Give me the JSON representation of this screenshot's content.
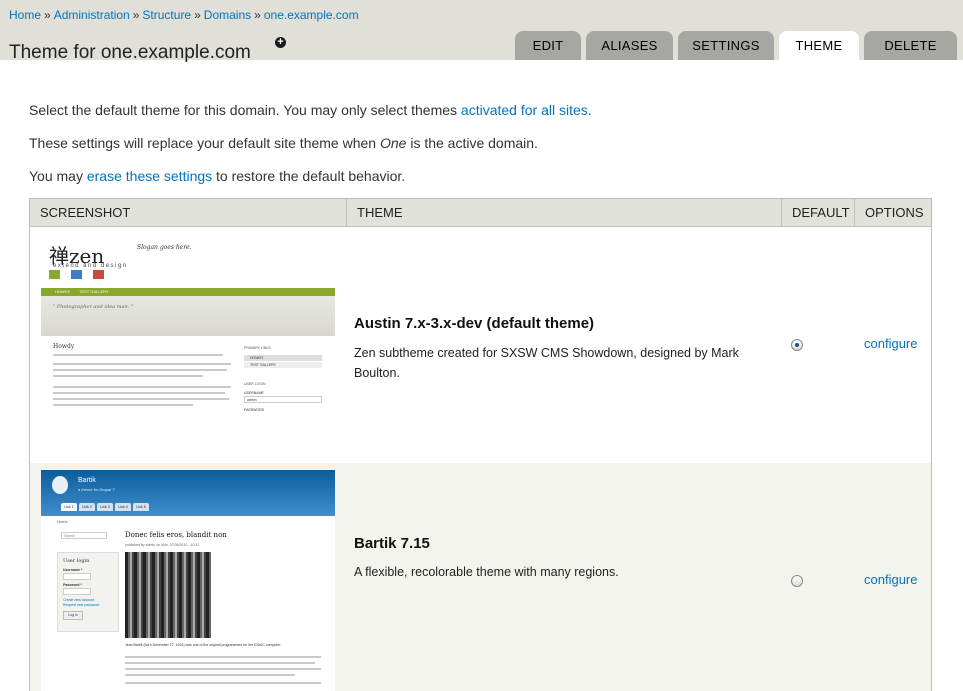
{
  "breadcrumb": {
    "items": [
      "Home",
      "Administration",
      "Structure",
      "Domains",
      "one.example.com"
    ],
    "separator": "»"
  },
  "page": {
    "title": "Theme for one.example.com",
    "shortcut_icon": "plus-circle-icon"
  },
  "tabs": [
    {
      "label": "Edit",
      "active": false
    },
    {
      "label": "Aliases",
      "active": false
    },
    {
      "label": "Settings",
      "active": false
    },
    {
      "label": "Theme",
      "active": true
    },
    {
      "label": "Delete",
      "active": false
    }
  ],
  "intro": {
    "p1_before": "Select the default theme for this domain. You may only select themes ",
    "p1_link": "activated for all sites",
    "p1_after": ".",
    "p2_before": "These settings will replace your default site theme when ",
    "p2_em": "One",
    "p2_after": " is the active domain.",
    "p3_before": "You may ",
    "p3_link": "erase these settings",
    "p3_after": " to restore the default behavior."
  },
  "table": {
    "headers": [
      "Screenshot",
      "Theme",
      "Default",
      "Options"
    ],
    "rows": [
      {
        "name": "Austin 7.x-3.x-dev (default theme)",
        "description": "Zen subtheme created for SXSW CMS Showdown, designed by Mark Boulton.",
        "is_default": true,
        "option": "configure",
        "screenshot": {
          "logo": "禅zen",
          "tagline": "extend and design",
          "slogan": "Slogan goes here.",
          "nav": [
            "HOWDY",
            "TEST GALLERY"
          ],
          "hero_text": "\" Photographer and idea man. \"",
          "heading": "Howdy",
          "side_heading": "PRIMARY LINKS",
          "side_items": [
            "HOWDY",
            "TEST GALLERY"
          ],
          "login_heading": "USER LOGIN",
          "username_label": "USERNAME",
          "username_value": "admin",
          "password_label": "PASSWORD"
        }
      },
      {
        "name": "Bartik 7.15",
        "description": "A flexible, recolorable theme with many regions.",
        "is_default": false,
        "option": "configure",
        "screenshot": {
          "site_name": "Bartik",
          "slogan": "a theme for Drupal 7",
          "tabs": [
            "Link 1",
            "Link 2",
            "Link 3",
            "Link 4",
            "Link 5"
          ],
          "home_link": "Home",
          "search_placeholder": "Search",
          "article_title": "Donec felis eros, blandit non",
          "byline": "published by admin on Mon, 07/05/2010 - 10:32",
          "login_heading": "User login",
          "username_label": "Username *",
          "password_label": "Password *",
          "links": [
            "Create new account",
            "Request new password"
          ],
          "login_button": "Log in",
          "caption": "Jean Bartik (born December 27, 1924) was one of the original programmers for the ENIAC computer."
        }
      }
    ]
  },
  "colors": {
    "link": "#0074bd",
    "header_bg": "#e0e0d8",
    "tab_bg": "#a6a7a2",
    "table_head_bg": "#e1e2dc",
    "row_alt_bg": "#f3f4ee"
  }
}
